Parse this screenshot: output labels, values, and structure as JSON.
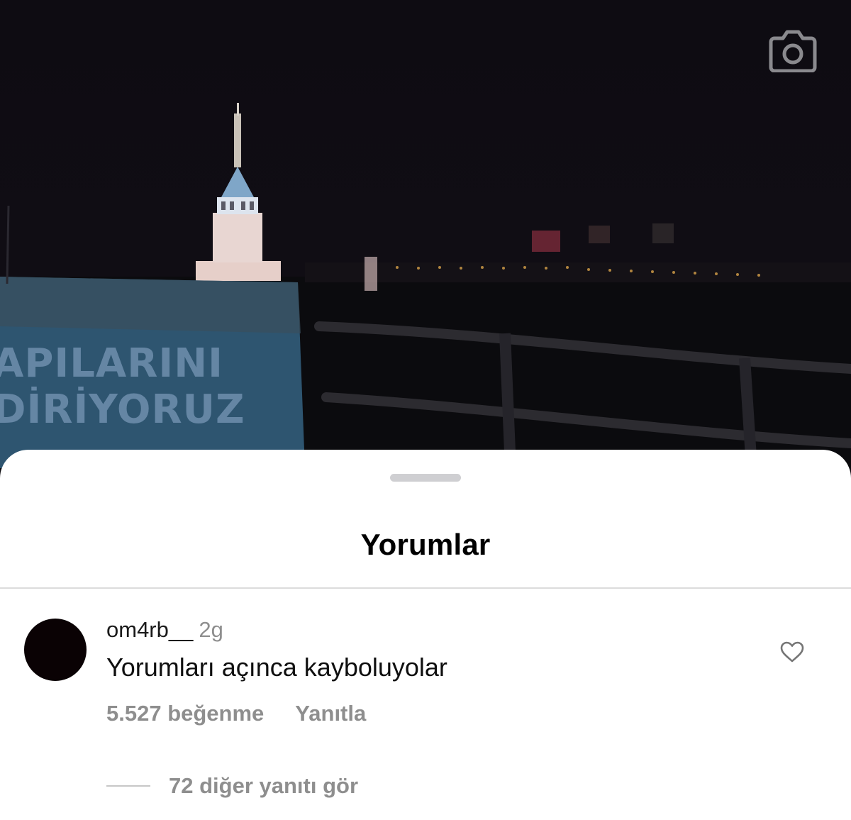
{
  "video": {
    "sign_line1": "APILARINI",
    "sign_line2": "DİRİYORUZ",
    "camera_icon": "camera-icon"
  },
  "sheet": {
    "title": "Yorumlar"
  },
  "comment": {
    "username": "om4rb__",
    "timestamp": "2g",
    "text": "Yorumları açınca kayboluyolar",
    "likes": "5.527 beğenme",
    "reply_label": "Yanıtla",
    "view_replies_label": "72 diğer yanıtı gör",
    "like_icon": "heart-outline-icon"
  },
  "colors": {
    "sheet_background": "#ffffff",
    "secondary_text": "#8e8e8e",
    "primary_text": "#0f0f0f",
    "avatar": "#0a0204"
  }
}
